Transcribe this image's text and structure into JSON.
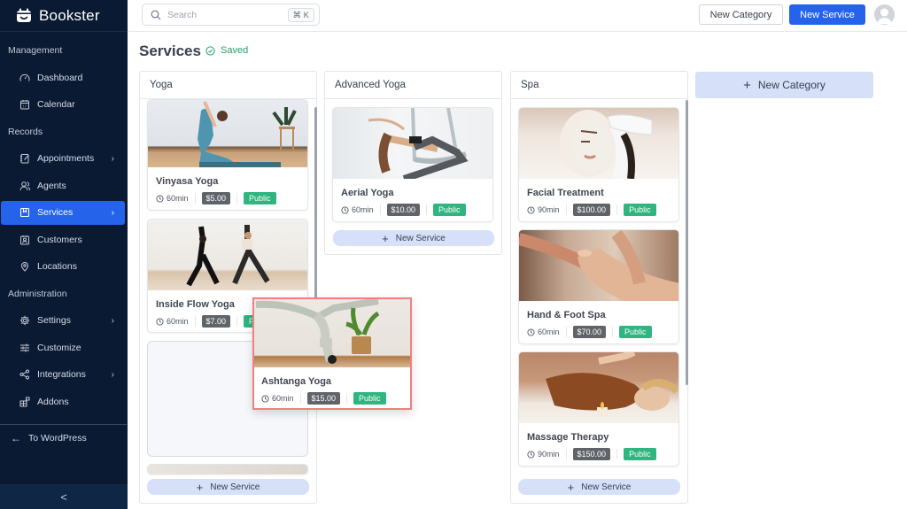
{
  "app": {
    "name": "Bookster"
  },
  "sidebar": {
    "sections": [
      {
        "label": "Management",
        "items": [
          {
            "label": "Dashboard",
            "icon": "gauge-icon"
          },
          {
            "label": "Calendar",
            "icon": "calendar-icon"
          }
        ]
      },
      {
        "label": "Records",
        "items": [
          {
            "label": "Appointments",
            "icon": "notebook-edit-icon",
            "chevron": true
          },
          {
            "label": "Agents",
            "icon": "users-icon"
          },
          {
            "label": "Services",
            "icon": "bookmark-box-icon",
            "chevron": true,
            "active": true
          },
          {
            "label": "Customers",
            "icon": "contact-card-icon"
          },
          {
            "label": "Locations",
            "icon": "map-pin-icon"
          }
        ]
      },
      {
        "label": "Administration",
        "items": [
          {
            "label": "Settings",
            "icon": "gear-icon",
            "chevron": true
          },
          {
            "label": "Customize",
            "icon": "sliders-icon"
          },
          {
            "label": "Integrations",
            "icon": "share-nodes-icon",
            "chevron": true
          },
          {
            "label": "Addons",
            "icon": "blocks-icon"
          }
        ]
      }
    ],
    "back_link": "To WordPress",
    "collapse_glyph": "<"
  },
  "topbar": {
    "search_placeholder": "Search",
    "search_shortcut": "⌘ K",
    "new_category_label": "New Category",
    "new_service_label": "New Service"
  },
  "page": {
    "title": "Services",
    "status": "Saved"
  },
  "columns": [
    {
      "title": "Yoga",
      "services": [
        {
          "name": "Vinyasa Yoga",
          "duration": "60min",
          "price": "$5.00",
          "visibility": "Public"
        },
        {
          "name": "Inside Flow Yoga",
          "duration": "60min",
          "price": "$7.00",
          "visibility": "Public"
        }
      ],
      "add_label": "New Service"
    },
    {
      "title": "Advanced Yoga",
      "services": [
        {
          "name": "Aerial Yoga",
          "duration": "60min",
          "price": "$10.00",
          "visibility": "Public"
        }
      ],
      "add_label": "New Service"
    },
    {
      "title": "Spa",
      "services": [
        {
          "name": "Facial Treatment",
          "duration": "90min",
          "price": "$100.00",
          "visibility": "Public"
        },
        {
          "name": "Hand & Foot Spa",
          "duration": "60min",
          "price": "$70.00",
          "visibility": "Public"
        },
        {
          "name": "Massage Therapy",
          "duration": "90min",
          "price": "$150.00",
          "visibility": "Public"
        }
      ],
      "add_label": "New Service"
    }
  ],
  "dragging": {
    "name": "Ashtanga Yoga",
    "duration": "60min",
    "price": "$15.00",
    "visibility": "Public"
  },
  "new_category_column_label": "New Category",
  "colors": {
    "primary": "#2563eb",
    "sidebar_bg": "#0b1a33",
    "public_badge": "#2fb57f",
    "price_badge": "#606469",
    "saved": "#22a06b",
    "drag_border": "#f08080"
  }
}
